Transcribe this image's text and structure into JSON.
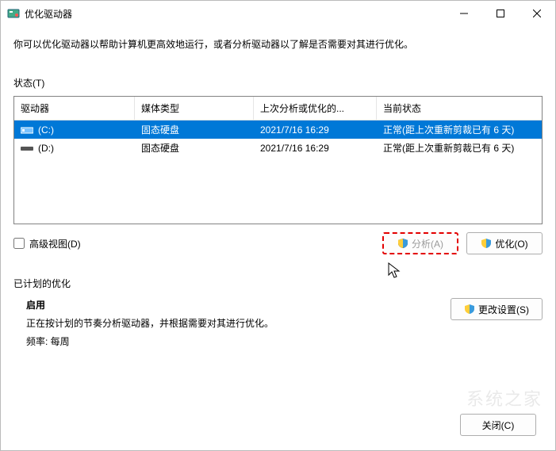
{
  "window": {
    "title": "优化驱动器"
  },
  "description": "你可以优化驱动器以帮助计算机更高效地运行，或者分析驱动器以了解是否需要对其进行优化。",
  "status_label": "状态(T)",
  "columns": {
    "drive": "驱动器",
    "media": "媒体类型",
    "last": "上次分析或优化的...",
    "status": "当前状态"
  },
  "rows": [
    {
      "icon": "c",
      "drive": "(C:)",
      "media": "固态硬盘",
      "last": "2021/7/16 16:29",
      "status": "正常(距上次重新剪裁已有 6 天)",
      "selected": true
    },
    {
      "icon": "d",
      "drive": "(D:)",
      "media": "固态硬盘",
      "last": "2021/7/16 16:29",
      "status": "正常(距上次重新剪裁已有 6 天)",
      "selected": false
    }
  ],
  "advanced_view": "高级视图(D)",
  "buttons": {
    "analyze": "分析(A)",
    "optimize": "优化(O)",
    "change_settings": "更改设置(S)",
    "close": "关闭(C)"
  },
  "scheduled": {
    "title": "已计划的优化",
    "heading": "启用",
    "desc": "正在按计划的节奏分析驱动器，并根据需要对其进行优化。",
    "freq_label": "频率: 每周"
  },
  "watermark": "系统之家"
}
